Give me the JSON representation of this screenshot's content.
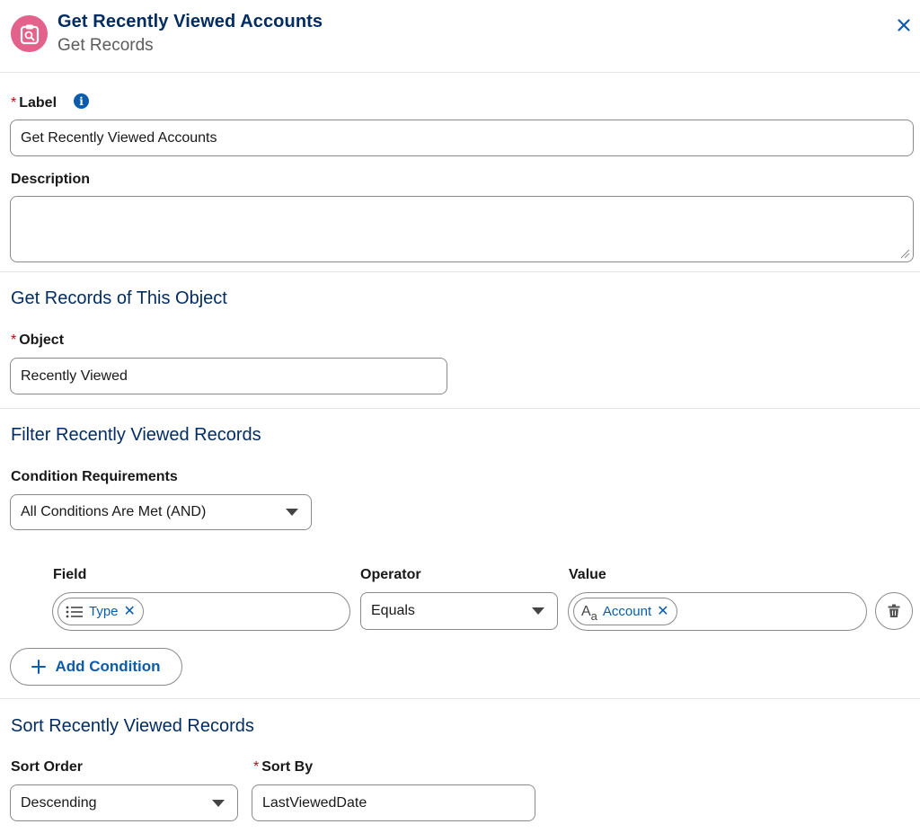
{
  "header": {
    "title": "Get Recently Viewed Accounts",
    "subtitle": "Get Records",
    "icon": "get-records-icon",
    "icon_color": "#e3628b"
  },
  "label_field": {
    "required_mark": "*",
    "label": "Label",
    "value": "Get Recently Viewed Accounts"
  },
  "description_field": {
    "label": "Description",
    "value": ""
  },
  "object_section": {
    "title": "Get Records of This Object",
    "object_label": "Object",
    "required_mark": "*",
    "object_value": "Recently Viewed"
  },
  "filter_section": {
    "title": "Filter Recently Viewed Records",
    "condition_label": "Condition Requirements",
    "condition_value": "All Conditions Are Met (AND)",
    "columns": {
      "field": "Field",
      "operator": "Operator",
      "value": "Value"
    },
    "row": {
      "field_pill": "Type",
      "operator": "Equals",
      "value_pill": "Account",
      "value_icon_glyph": "A",
      "value_icon_sub": "a"
    },
    "add_condition": "Add Condition"
  },
  "sort_section": {
    "title": "Sort Recently Viewed Records",
    "sort_order_label": "Sort Order",
    "sort_order_value": "Descending",
    "sort_by_label": "Sort By",
    "required_mark": "*",
    "sort_by_value": "LastViewedDate"
  },
  "colors": {
    "brand_navy": "#032d60",
    "link_blue": "#0b5cab",
    "required_red": "#ba0517"
  }
}
